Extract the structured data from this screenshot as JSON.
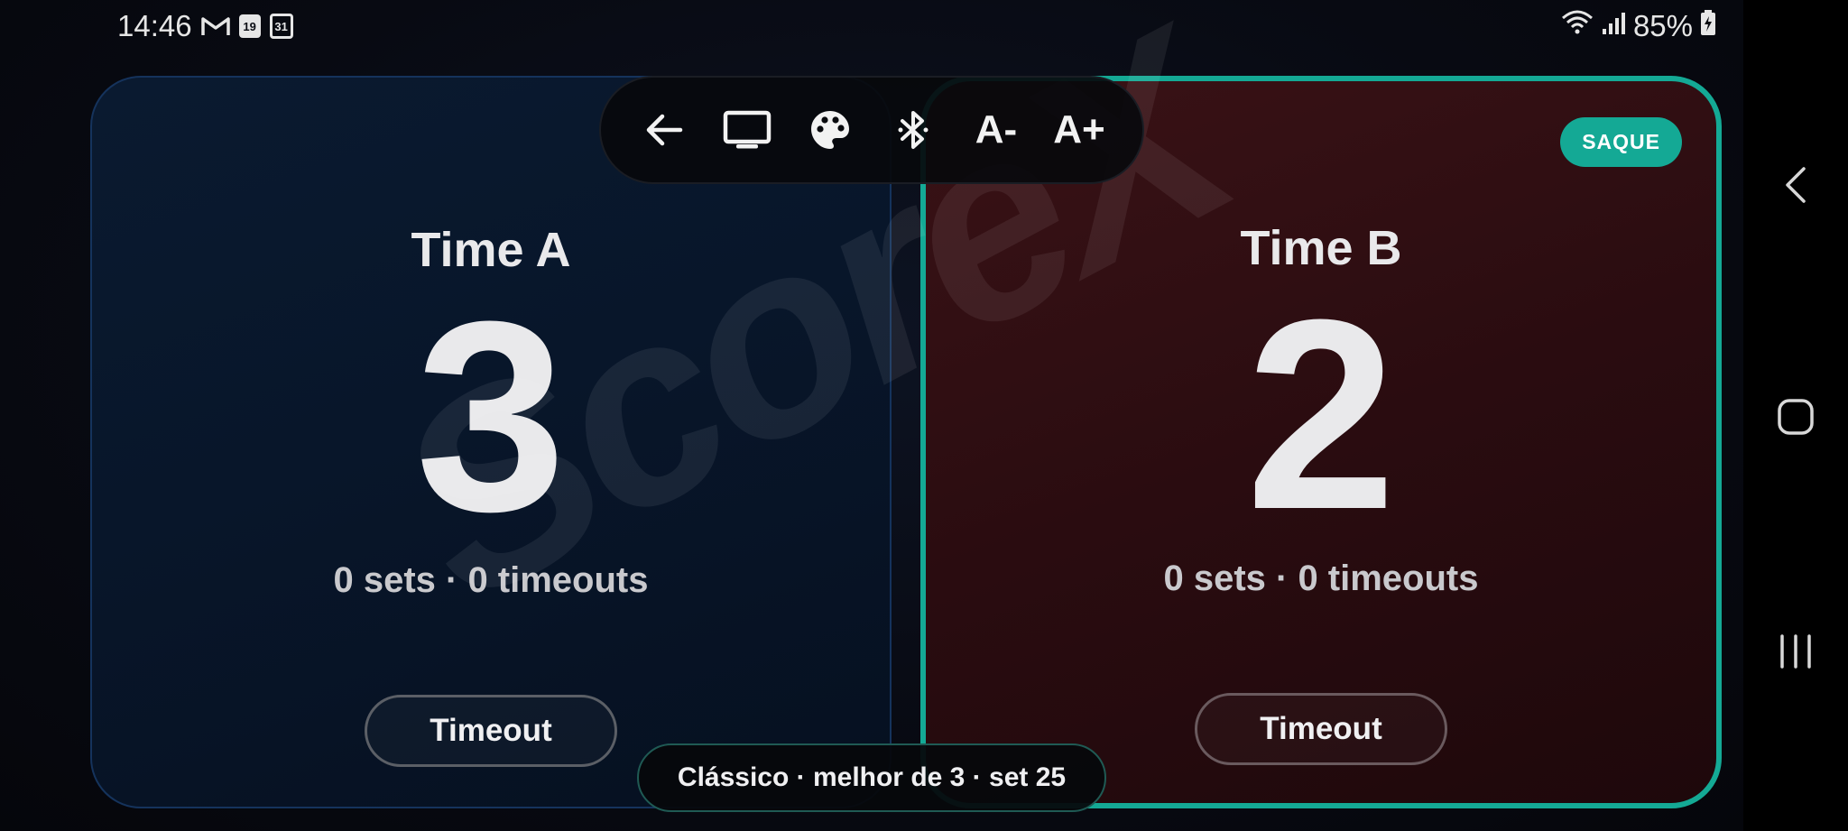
{
  "status_bar": {
    "time": "14:46",
    "calendar_day_1": "19",
    "calendar_day_2": "31",
    "battery": "85%"
  },
  "toolbar": {
    "icons": [
      "back-arrow-icon",
      "tv-icon",
      "palette-icon",
      "bluetooth-icon"
    ],
    "font_decrease_label": "A-",
    "font_increase_label": "A+"
  },
  "watermark": "ScoreX",
  "team_a": {
    "name": "Time A",
    "score": "3",
    "subtitle": "0 sets · 0 timeouts",
    "timeout_label": "Timeout",
    "color": "#0a1a30"
  },
  "team_b": {
    "name": "Time B",
    "score": "2",
    "subtitle": "0 sets · 0 timeouts",
    "timeout_label": "Timeout",
    "serve_badge": "SAQUE",
    "color": "#2a0c10",
    "highlight_color": "#14a995"
  },
  "mode": "Clássico · melhor de 3 · set 25"
}
